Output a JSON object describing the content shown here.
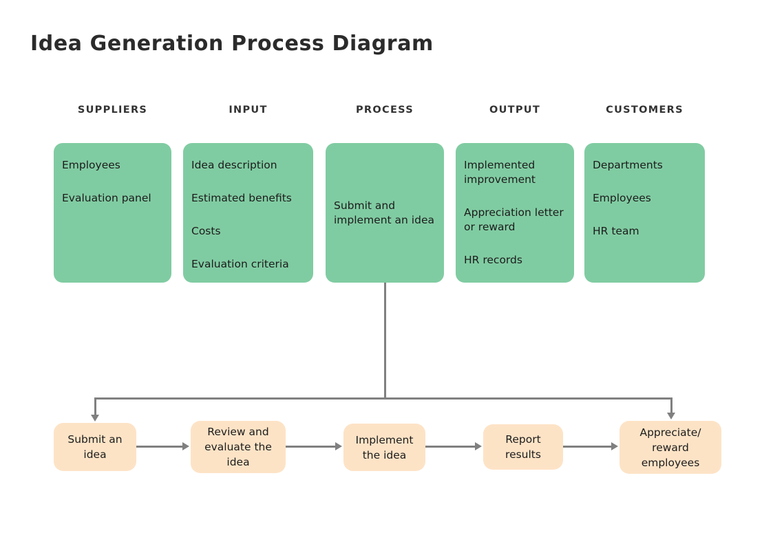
{
  "page": {
    "title": "Idea Generation Process Diagram",
    "background_color": "#ffffff",
    "outer_color": "#000000"
  },
  "colors": {
    "sipoc_box_fill": "#80cca2",
    "flow_box_fill": "#fde3c6",
    "connector": "#808080",
    "title_text": "#2b2b2b",
    "header_text": "#333333",
    "body_text": "#1c1c1c"
  },
  "sipoc": {
    "columns": [
      {
        "header": "SUPPLIERS",
        "items": [
          "Employees",
          "Evaluation panel"
        ]
      },
      {
        "header": "INPUT",
        "items": [
          "Idea description",
          "Estimated benefits",
          "Costs",
          "Evaluation criteria"
        ]
      },
      {
        "header": "PROCESS",
        "items": [
          "Submit and implement an idea"
        ]
      },
      {
        "header": "OUTPUT",
        "items": [
          "Implemented improvement",
          "Appreciation letter or reward",
          "HR records"
        ]
      },
      {
        "header": "CUSTOMERS",
        "items": [
          "Departments",
          "Employees",
          "HR team"
        ]
      }
    ]
  },
  "process_flow": {
    "steps": [
      {
        "label": "Submit an idea"
      },
      {
        "label": "Review and evaluate the idea"
      },
      {
        "label": "Implement the idea"
      },
      {
        "label": "Report results"
      },
      {
        "label": "Appreciate/ reward employees"
      }
    ]
  }
}
